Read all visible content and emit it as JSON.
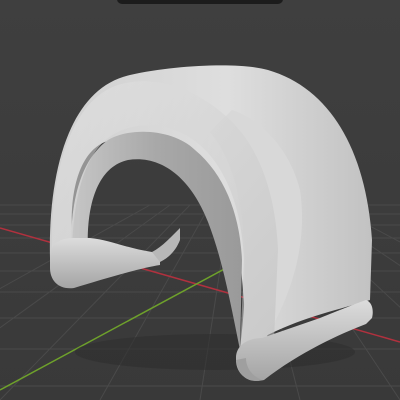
{
  "viewport": {
    "background_color": "#3d3d3d",
    "grid_color": "#4a4a4a",
    "x_axis_color": "#b0313e",
    "y_axis_color": "#6ea12b",
    "model_color": "#d6d6d6",
    "model_shade_color": "#a9a9a9"
  },
  "icons": {
    "header_tab": "header-tab"
  }
}
